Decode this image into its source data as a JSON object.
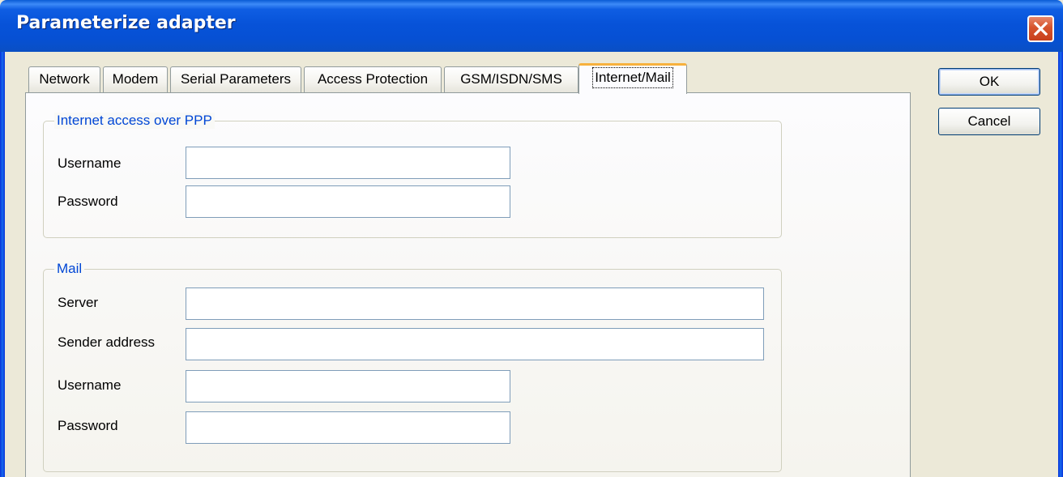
{
  "window": {
    "title": "Parameterize adapter",
    "close_icon": "close-icon"
  },
  "tabs": [
    {
      "label": "Network",
      "active": false
    },
    {
      "label": "Modem",
      "active": false
    },
    {
      "label": "Serial Parameters",
      "active": false
    },
    {
      "label": "Access Protection",
      "active": false
    },
    {
      "label": "GSM/ISDN/SMS",
      "active": false
    },
    {
      "label": "Internet/Mail",
      "active": true
    }
  ],
  "ppp_group": {
    "title": "Internet access over PPP",
    "username_label": "Username",
    "username_value": "",
    "password_label": "Password",
    "password_value": ""
  },
  "mail_group": {
    "title": "Mail",
    "server_label": "Server",
    "server_value": "",
    "sender_label": "Sender address",
    "sender_value": "",
    "username_label": "Username",
    "username_value": "",
    "password_label": "Password",
    "password_value": ""
  },
  "buttons": {
    "ok_label": "OK",
    "cancel_label": "Cancel"
  },
  "colors": {
    "titlebar": "#0650d4",
    "group_label": "#0046d5",
    "active_tab_highlight": "#f7b13d",
    "close_button": "#d6542d"
  }
}
